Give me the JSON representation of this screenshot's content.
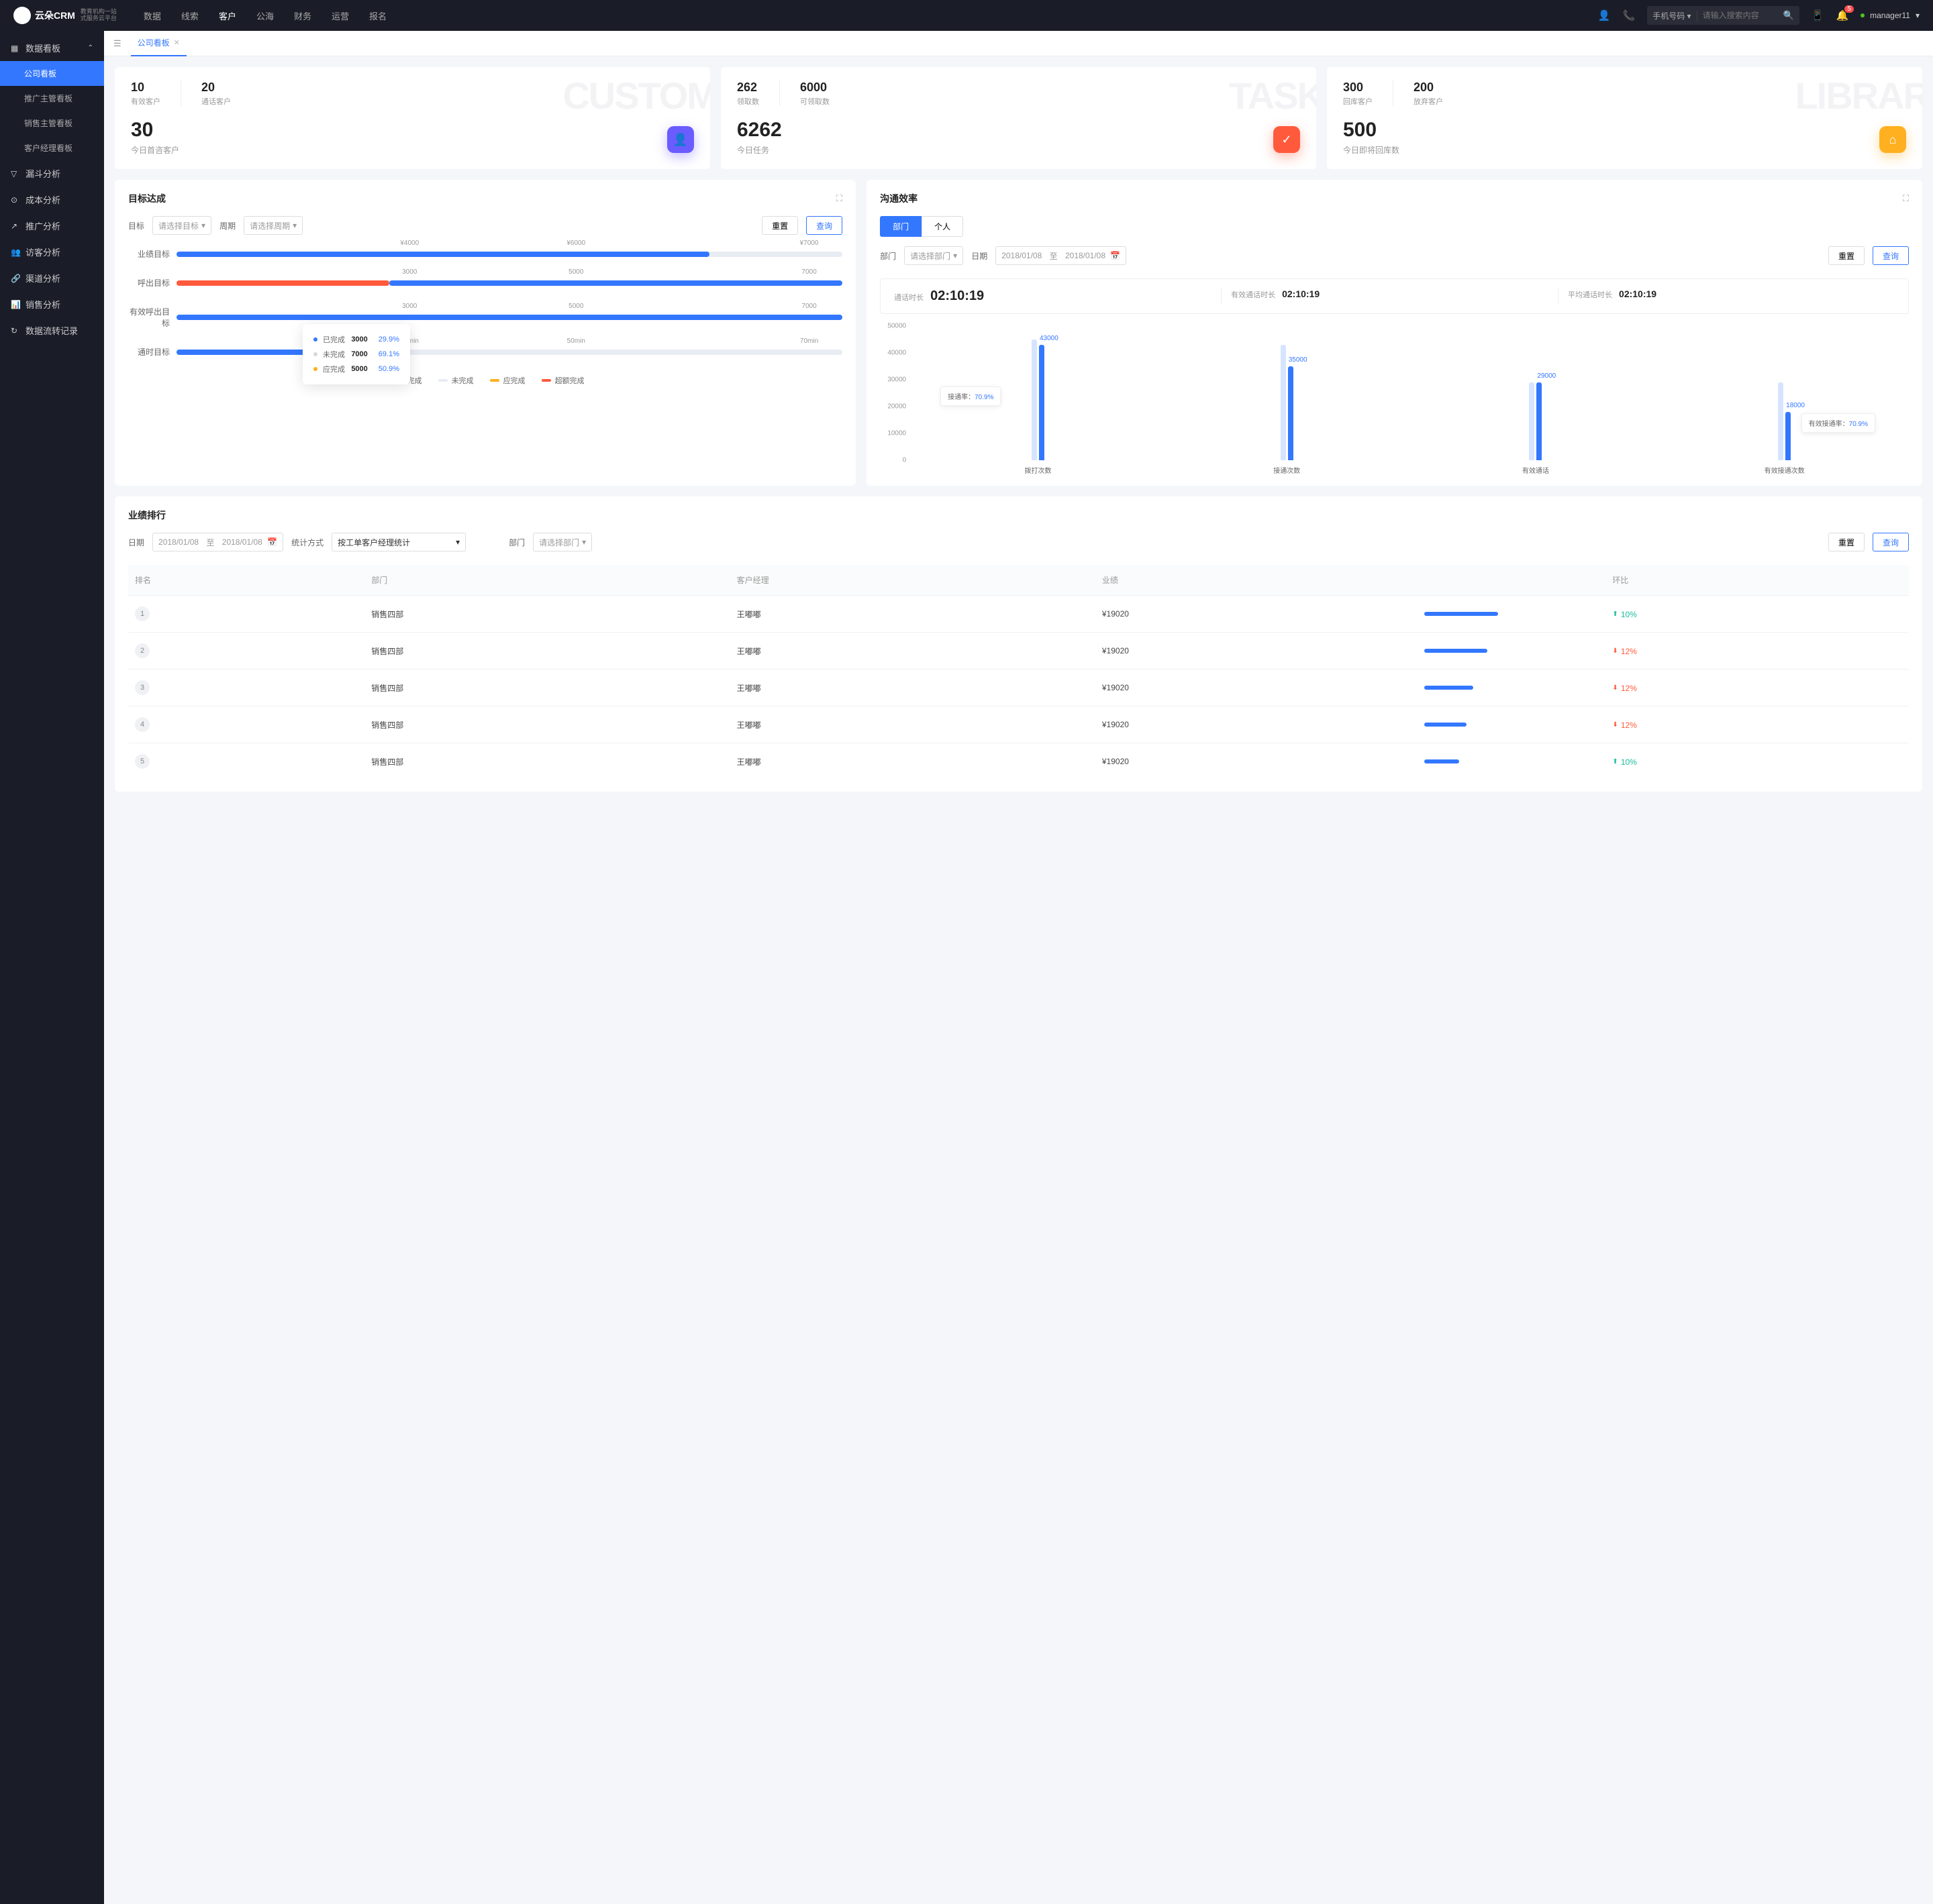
{
  "header": {
    "logo_text": "云朵CRM",
    "logo_sub1": "教育机构一站",
    "logo_sub2": "式服务云平台",
    "nav": [
      "数据",
      "线索",
      "客户",
      "公海",
      "财务",
      "运营",
      "报名"
    ],
    "nav_active": 2,
    "search_type": "手机号码",
    "search_placeholder": "请输入搜索内容",
    "badge": "5",
    "user": "manager11"
  },
  "sidebar": {
    "group_title": "数据看板",
    "items": [
      "公司看板",
      "推广主管看板",
      "销售主管看板",
      "客户经理看板"
    ],
    "active": 0,
    "others": [
      "漏斗分析",
      "成本分析",
      "推广分析",
      "访客分析",
      "渠道分析",
      "销售分析",
      "数据流转记录"
    ]
  },
  "tab": {
    "label": "公司看板"
  },
  "stats": [
    {
      "ghost": "CUSTOM",
      "a_num": "10",
      "a_lab": "有效客户",
      "b_num": "20",
      "b_lab": "通话客户",
      "big": "30",
      "big_lab": "今日首咨客户",
      "ic": "ic-purple",
      "glyph": "👤"
    },
    {
      "ghost": "TASK",
      "a_num": "262",
      "a_lab": "领取数",
      "b_num": "6000",
      "b_lab": "可领取数",
      "big": "6262",
      "big_lab": "今日任务",
      "ic": "ic-red",
      "glyph": "✓"
    },
    {
      "ghost": "LIBRAR",
      "a_num": "300",
      "a_lab": "回库客户",
      "b_num": "200",
      "b_lab": "放弃客户",
      "big": "500",
      "big_lab": "今日即将回库数",
      "ic": "ic-yellow",
      "glyph": "⌂"
    }
  ],
  "goals": {
    "title": "目标达成",
    "labels": {
      "target": "目标",
      "period": "周期",
      "target_ph": "请选择目标",
      "period_ph": "请选择周期",
      "reset": "重置",
      "query": "查询"
    },
    "rows": [
      {
        "name": "业绩目标",
        "ticks": [
          "¥4000",
          "¥6000",
          "¥7000"
        ],
        "bars": [
          {
            "cls": "bar-blue",
            "w": 80
          }
        ]
      },
      {
        "name": "呼出目标",
        "ticks": [
          "3000",
          "5000",
          "7000"
        ],
        "bars": [
          {
            "cls": "bar-red",
            "w": 32
          },
          {
            "cls": "bar-blue",
            "w": 68,
            "left": 32
          }
        ]
      },
      {
        "name": "有效呼出目标",
        "ticks": [
          "3000",
          "5000",
          "7000"
        ],
        "bars": [
          {
            "cls": "bar-blue",
            "w": 100
          }
        ]
      },
      {
        "name": "通时目标",
        "ticks": [
          "30min",
          "50min",
          "70min"
        ],
        "bars": [
          {
            "cls": "bar-blue",
            "w": 30
          }
        ]
      }
    ],
    "tooltip": [
      {
        "dot": "#3377ff",
        "name": "已完成",
        "val": "3000",
        "pct": "29.9%"
      },
      {
        "dot": "#d9d9d9",
        "name": "未完成",
        "val": "7000",
        "pct": "69.1%"
      },
      {
        "dot": "#ffb020",
        "name": "应完成",
        "val": "5000",
        "pct": "50.9%"
      }
    ],
    "legend": [
      {
        "c": "#3377ff",
        "t": "已完成"
      },
      {
        "c": "#e8ecf3",
        "t": "未完成"
      },
      {
        "c": "#ffb020",
        "t": "应完成"
      },
      {
        "c": "#ff5a3c",
        "t": "超额完成"
      }
    ]
  },
  "eff": {
    "title": "沟通效率",
    "seg": [
      "部门",
      "个人"
    ],
    "dept_label": "部门",
    "dept_ph": "请选择部门",
    "date_label": "日期",
    "date_from": "2018/01/08",
    "date_sep": "至",
    "date_to": "2018/01/08",
    "reset": "重置",
    "query": "查询",
    "metrics": [
      {
        "l": "通话时长",
        "v": "02:10:19"
      },
      {
        "l": "有效通话时长",
        "v": "02:10:19"
      },
      {
        "l": "平均通话时长",
        "v": "02:10:19"
      }
    ],
    "float1": {
      "l": "接通率：",
      "v": "70.9%"
    },
    "float2": {
      "l": "有效接通率：",
      "v": "70.9%"
    }
  },
  "chart_data": {
    "type": "bar",
    "ylim": [
      0,
      50000
    ],
    "yticks": [
      0,
      10000,
      20000,
      30000,
      40000,
      50000
    ],
    "categories": [
      "拨打次数",
      "接通次数",
      "有效通话",
      "有效接通次数"
    ],
    "series": [
      {
        "name": "total",
        "values": [
          45000,
          43000,
          29000,
          29000
        ],
        "color": "#d6e4ff"
      },
      {
        "name": "actual",
        "values": [
          43000,
          35000,
          29000,
          18000
        ],
        "color": "#3377ff"
      }
    ],
    "value_labels": [
      43000,
      35000,
      29000,
      18000
    ]
  },
  "rank": {
    "title": "业绩排行",
    "date_label": "日期",
    "date_from": "2018/01/08",
    "date_sep": "至",
    "date_to": "2018/01/08",
    "method_label": "统计方式",
    "method": "按工单客户经理统计",
    "dept_label": "部门",
    "dept_ph": "请选择部门",
    "reset": "重置",
    "query": "查询",
    "cols": [
      "排名",
      "部门",
      "客户经理",
      "业绩",
      "",
      "环比"
    ],
    "rows": [
      {
        "r": "1",
        "d": "销售四部",
        "m": "王嘟嘟",
        "p": "¥19020",
        "bar": 42,
        "dir": "up",
        "pct": "10%"
      },
      {
        "r": "2",
        "d": "销售四部",
        "m": "王嘟嘟",
        "p": "¥19020",
        "bar": 36,
        "dir": "down",
        "pct": "12%"
      },
      {
        "r": "3",
        "d": "销售四部",
        "m": "王嘟嘟",
        "p": "¥19020",
        "bar": 28,
        "dir": "down",
        "pct": "12%"
      },
      {
        "r": "4",
        "d": "销售四部",
        "m": "王嘟嘟",
        "p": "¥19020",
        "bar": 24,
        "dir": "down",
        "pct": "12%"
      },
      {
        "r": "5",
        "d": "销售四部",
        "m": "王嘟嘟",
        "p": "¥19020",
        "bar": 20,
        "dir": "up",
        "pct": "10%"
      }
    ]
  }
}
